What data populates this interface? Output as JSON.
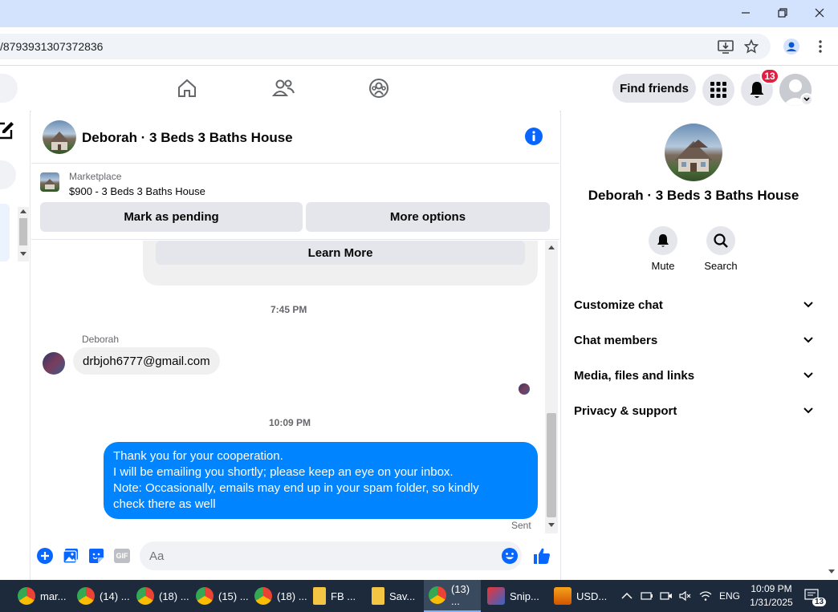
{
  "browser": {
    "url_fragment": "/8793931307372836"
  },
  "fbnav": {
    "find_friends_label": "Find friends",
    "notification_count": "13"
  },
  "chat": {
    "title": "Deborah · 3 Beds 3 Baths House",
    "marketplace_label": "Marketplace",
    "listing": "$900 - 3 Beds 3 Baths House",
    "mark_pending_label": "Mark as pending",
    "more_options_label": "More options",
    "learn_more_label": "Learn More",
    "timestamp_1": "7:45 PM",
    "sender_name": "Deborah",
    "incoming_message": "drbjoh6777@gmail.com",
    "timestamp_2": "10:09 PM",
    "outgoing_lines": [
      "Thank you for your cooperation.",
      "I will be emailing you shortly; please keep an eye on your inbox.",
      "Note: Occasionally, emails may end up in your spam folder, so kindly",
      "check there as well"
    ],
    "sent_label": "Sent",
    "input_placeholder": "Aa",
    "gif_label": "GIF"
  },
  "right_panel": {
    "title": "Deborah · 3 Beds 3 Baths House",
    "mute_label": "Mute",
    "search_label": "Search",
    "rows": [
      "Customize chat",
      "Chat members",
      "Media, files and links",
      "Privacy & support"
    ]
  },
  "taskbar": {
    "items": [
      "mar...",
      "(14) ...",
      "(18) ...",
      "(15) ...",
      "(18) ...",
      "FB ...",
      "Sav...",
      "(13) ...",
      "Snip...",
      "USD..."
    ],
    "language": "ENG",
    "time": "10:09 PM",
    "date": "1/31/2025",
    "notif_count": "13"
  },
  "colors": {
    "messenger_blue": "#0084ff",
    "fb_blue": "#0866ff",
    "badge_red": "#e41e3f"
  }
}
